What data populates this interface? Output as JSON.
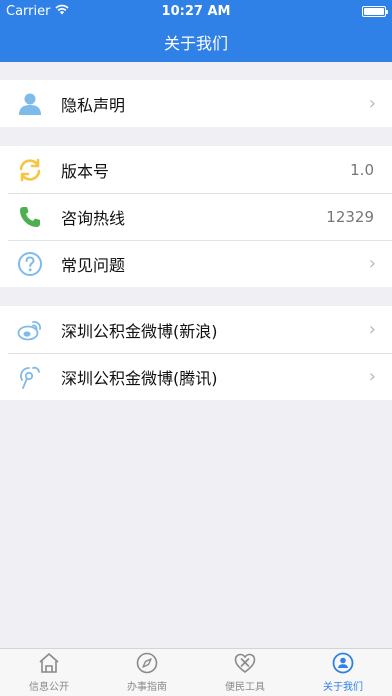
{
  "status_bar": {
    "carrier": "Carrier",
    "time": "10:27 AM"
  },
  "nav": {
    "title": "关于我们"
  },
  "groups": [
    {
      "rows": [
        {
          "label": "隐私声明",
          "icon": "person-icon",
          "value": ""
        }
      ]
    },
    {
      "rows": [
        {
          "label": "版本号",
          "icon": "refresh-icon",
          "value": "1.0"
        },
        {
          "label": "咨询热线",
          "icon": "phone-icon",
          "value": "12329"
        },
        {
          "label": "常见问题",
          "icon": "question-icon",
          "value": ""
        }
      ]
    },
    {
      "rows": [
        {
          "label": "深圳公积金微博(新浪)",
          "icon": "sina-weibo-icon",
          "value": ""
        },
        {
          "label": "深圳公积金微博(腾讯)",
          "icon": "tencent-weibo-icon",
          "value": ""
        }
      ]
    }
  ],
  "tabs": [
    {
      "label": "信息公开",
      "icon": "house-icon",
      "active": false
    },
    {
      "label": "办事指南",
      "icon": "compass-icon",
      "active": false
    },
    {
      "label": "便民工具",
      "icon": "tools-heart-icon",
      "active": false
    },
    {
      "label": "关于我们",
      "icon": "person-circle-icon",
      "active": true
    }
  ],
  "colors": {
    "primary": "#2f80e7",
    "background": "#efeff4",
    "icon_blue": "#5aaae8",
    "icon_yellow": "#f5c543",
    "icon_green": "#4caf50"
  }
}
